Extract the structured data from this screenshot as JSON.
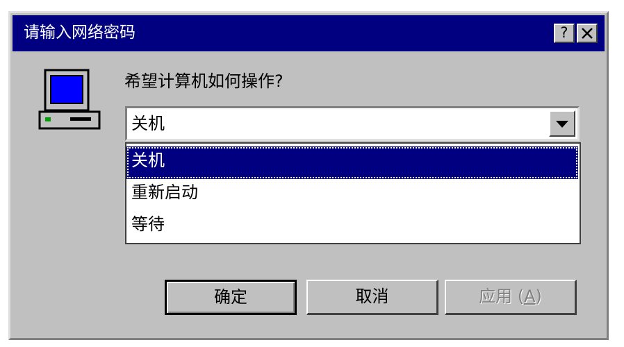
{
  "titlebar": {
    "title": "请输入网络密码",
    "help_label": "?",
    "close_label": "✕"
  },
  "icons": {
    "computer": "computer-icon",
    "help": "question-mark-icon",
    "close": "close-icon",
    "dropdown": "chevron-down-icon"
  },
  "dialog": {
    "prompt": "希望计算机如何操作?"
  },
  "combo": {
    "selected": "关机",
    "options": [
      "关机",
      "重新启动",
      "等待"
    ],
    "highlighted_index": 0
  },
  "buttons": {
    "ok_label": "确定",
    "cancel_label": "取消",
    "apply_label": "应用",
    "apply_mnemonic": "A",
    "apply_enabled": false
  },
  "colors": {
    "titlebar": "#000080",
    "face": "#c0c0c0",
    "selection": "#000080",
    "screen": "#0000ff"
  }
}
